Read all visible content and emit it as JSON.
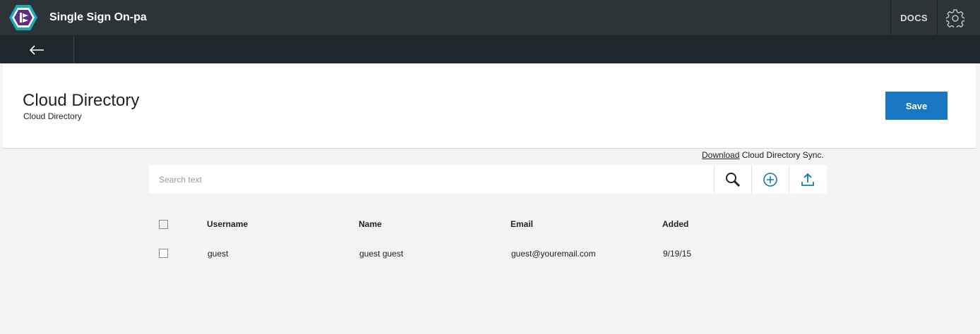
{
  "app": {
    "title": "Single Sign On-pa",
    "docs_label": "DOCS"
  },
  "page": {
    "title": "Cloud Directory",
    "subtitle": "Cloud Directory",
    "save_label": "Save"
  },
  "sync": {
    "link_text": "Download",
    "suffix_text": " Cloud Directory Sync."
  },
  "search": {
    "placeholder": "Search text",
    "value": ""
  },
  "table": {
    "columns": [
      "Username",
      "Name",
      "Email",
      "Added"
    ],
    "rows": [
      {
        "username": "guest",
        "name": "guest guest",
        "email": "guest@youremail.com",
        "added": "9/19/15"
      }
    ]
  },
  "colors": {
    "topbar": "#2d3438",
    "subbar": "#1e272c",
    "primary": "#1a78c2",
    "icon_blue": "#0f7ab8",
    "logo_teal": "#1aa9b9",
    "logo_purple": "#5b2f88"
  }
}
